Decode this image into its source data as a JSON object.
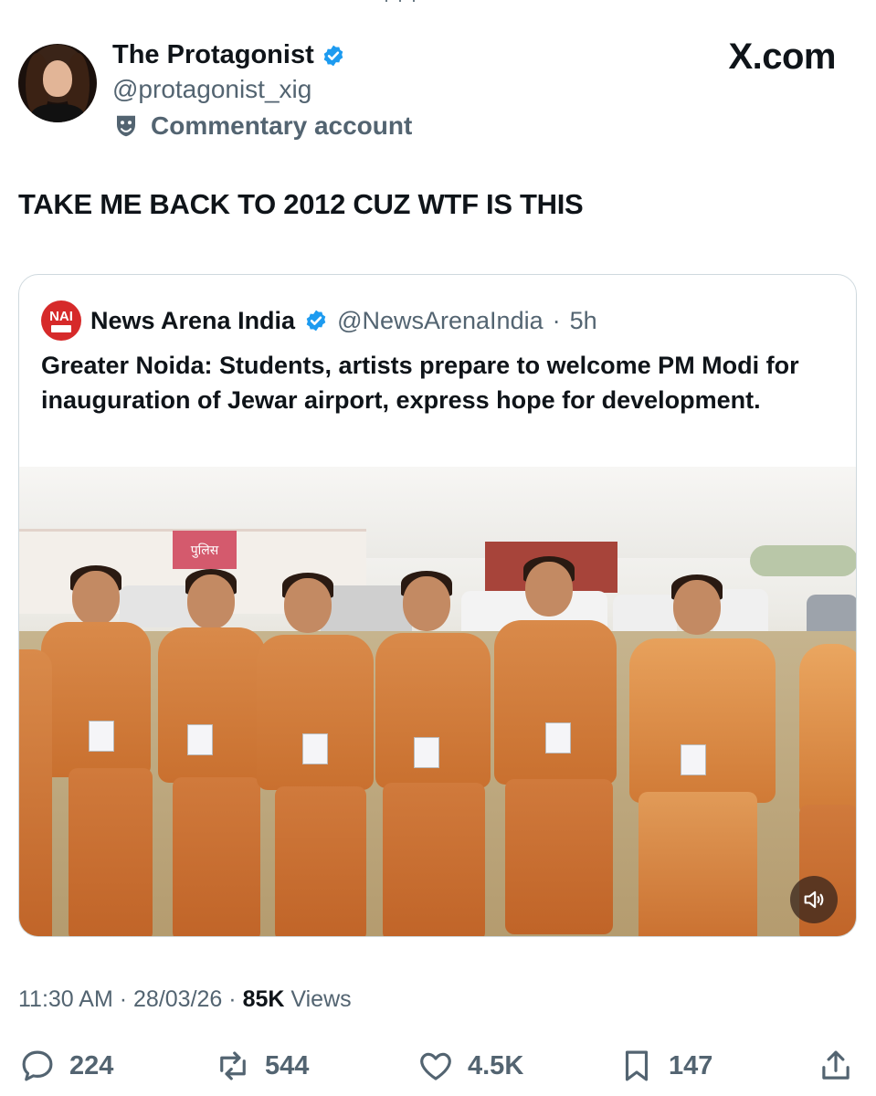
{
  "author": {
    "display_name": "The Protagonist",
    "handle": "@protagonist_xig",
    "label": "Commentary account"
  },
  "brand": "X.com",
  "tweet_text": "TAKE ME BACK TO 2012 CUZ WTF IS THIS",
  "quoted": {
    "logo_text": "NAI",
    "name": "News Arena India",
    "handle": "@NewsArenaIndia",
    "separator": "·",
    "age": "5h",
    "text": "Greater Noida: Students, artists prepare to welcome PM Modi for inauguration of Jewar airport, express hope for development.",
    "media_sign": "पुलिस"
  },
  "meta": {
    "time": "11:30 AM",
    "date": "28/03/26",
    "views_count": "85K",
    "views_label": "Views",
    "sep": "·"
  },
  "actions": {
    "replies": "224",
    "reposts": "544",
    "likes": "4.5K",
    "bookmarks": "147"
  },
  "colors": {
    "verified": "#1d9bf0",
    "secondary_text": "#536471",
    "nai_red": "#d62a2a"
  }
}
